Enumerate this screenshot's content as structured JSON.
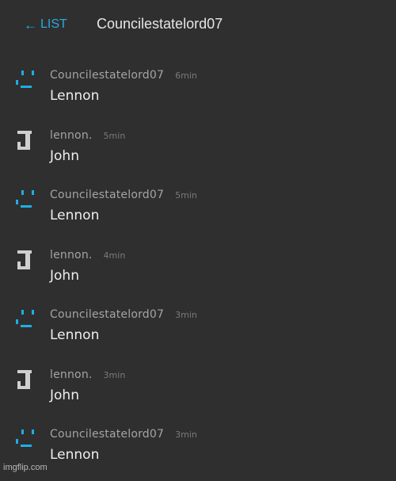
{
  "header": {
    "back_arrow": "←",
    "back_label": "LIST",
    "title": "Councilestatelord07"
  },
  "colors": {
    "background": "#2f2f2f",
    "accent": "#29a9e1",
    "avatar_blue": "#1eaee6",
    "avatar_gray": "#cfcfcf"
  },
  "messages": [
    {
      "username": "Councilestatelord07",
      "time": "6min",
      "text": "Lennon",
      "avatar_icon": "smiley-face-icon"
    },
    {
      "username": "lennon.",
      "time": "5min",
      "text": "John",
      "avatar_icon": "letter-j-icon"
    },
    {
      "username": "Councilestatelord07",
      "time": "5min",
      "text": "Lennon",
      "avatar_icon": "smiley-face-icon"
    },
    {
      "username": "lennon.",
      "time": "4min",
      "text": "John",
      "avatar_icon": "letter-j-icon"
    },
    {
      "username": "Councilestatelord07",
      "time": "3min",
      "text": "Lennon",
      "avatar_icon": "smiley-face-icon"
    },
    {
      "username": "lennon.",
      "time": "3min",
      "text": "John",
      "avatar_icon": "letter-j-icon"
    },
    {
      "username": "Councilestatelord07",
      "time": "3min",
      "text": "Lennon",
      "avatar_icon": "smiley-face-icon"
    }
  ],
  "watermark": "imgflip.com"
}
